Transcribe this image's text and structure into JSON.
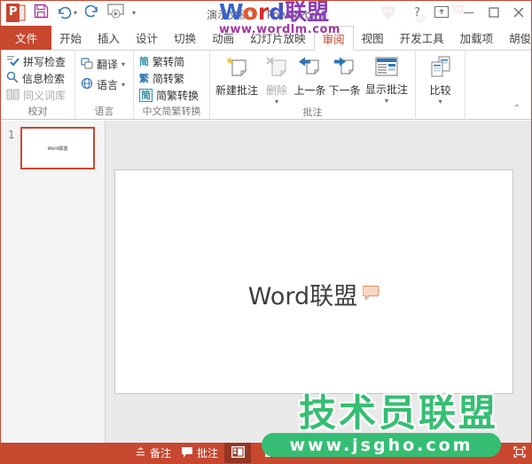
{
  "titlebar": {
    "title": "演示文稿1 - PowerPoint",
    "help": "?",
    "ppt_logo_letter": "P"
  },
  "tabs": [
    {
      "label": "文件"
    },
    {
      "label": "开始"
    },
    {
      "label": "插入"
    },
    {
      "label": "设计"
    },
    {
      "label": "切换"
    },
    {
      "label": "动画"
    },
    {
      "label": "幻灯片放映"
    },
    {
      "label": "审阅"
    },
    {
      "label": "视图"
    },
    {
      "label": "开发工具"
    },
    {
      "label": "加载项"
    },
    {
      "label": "胡俊"
    }
  ],
  "ribbon": {
    "proofing": {
      "label": "校对",
      "spell_check": "拼写检查",
      "research": "信息检索",
      "thesaurus": "同义词库"
    },
    "language": {
      "label": "语言",
      "translate": "翻译",
      "language": "语言"
    },
    "conversion": {
      "label": "中文简繁转换",
      "trad_to_simp": "繁转简",
      "simp_to_trad": "简转繁",
      "convert": "简繁转换",
      "icon_jian": "简",
      "icon_fan": "繁"
    },
    "comments": {
      "label": "批注",
      "new_comment": "新建批注",
      "delete": "删除",
      "previous": "上一条",
      "next": "下一条",
      "show_comments": "显示批注"
    },
    "compare": {
      "label": "",
      "compare": "比较"
    }
  },
  "slides_panel": {
    "slide_number": "1",
    "thumbnail_text": "Word联盟"
  },
  "slide": {
    "title_text": "Word联盟"
  },
  "status_bar": {
    "notes": "备注",
    "comments": "批注"
  },
  "watermarks": {
    "top_letters": [
      "W",
      "o",
      "r",
      "d"
    ],
    "top_suffix": "联盟",
    "top_url": "www.wordlm.com",
    "bottom_title": "技术员联盟",
    "bottom_url": "www.jsgho.com"
  },
  "colors": {
    "brand_orange": "#C8472F",
    "selected_view_overlay": "rgba(0,0,0,0.25)",
    "accent_blue": "#2E75B6",
    "watermark_green": "#35BE73",
    "watermark_purple": "#A238A0",
    "comment_bubble_fill": "#F8D8C2",
    "comment_bubble_border": "#DE9B74",
    "new_comment_star": "#F5C33B"
  }
}
